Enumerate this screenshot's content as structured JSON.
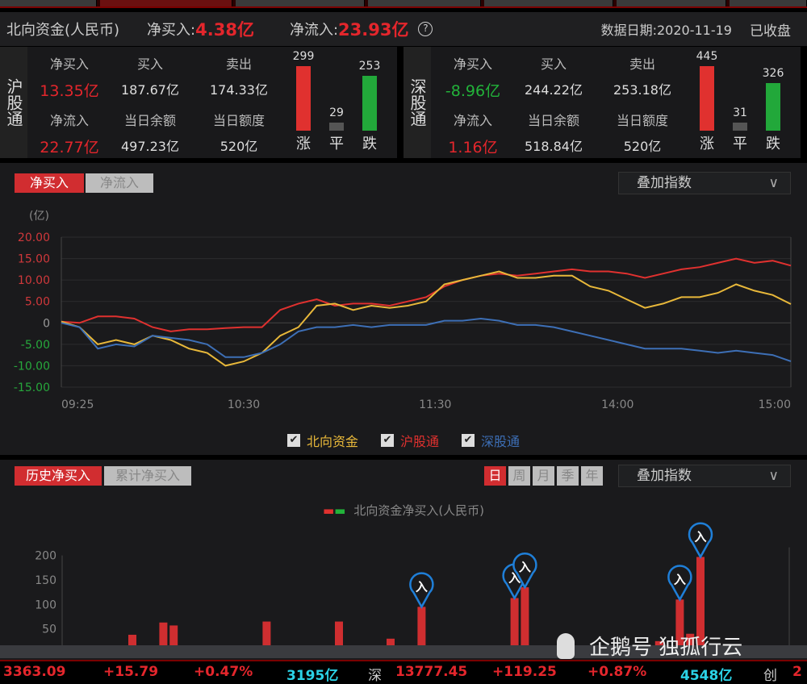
{
  "header": {
    "title": "北向资金(人民币)",
    "net_buy_label": "净买入:",
    "net_buy": "4.38亿",
    "net_flow_label": "净流入:",
    "net_flow": "23.93亿",
    "help_icon": "?",
    "date_label": "数据日期:2020-11-19",
    "status": "已收盘"
  },
  "sh": {
    "name": "沪股通",
    "net_buy_label": "净买入",
    "net_buy": "13.35亿",
    "buy_label": "买入",
    "buy": "187.67亿",
    "sell_label": "卖出",
    "sell": "174.33亿",
    "net_flow_label": "净流入",
    "net_flow": "22.77亿",
    "balance_label": "当日余额",
    "balance": "497.23亿",
    "quota_label": "当日额度",
    "quota": "520亿",
    "up": 299,
    "flat": 29,
    "down": 253,
    "up_label": "涨",
    "flat_label": "平",
    "down_label": "跌"
  },
  "sz": {
    "name": "深股通",
    "net_buy_label": "净买入",
    "net_buy": "-8.96亿",
    "buy_label": "买入",
    "buy": "244.22亿",
    "sell_label": "卖出",
    "sell": "253.18亿",
    "net_flow_label": "净流入",
    "net_flow": "1.16亿",
    "balance_label": "当日余额",
    "balance": "518.84亿",
    "quota_label": "当日额度",
    "quota": "520亿",
    "up": 445,
    "flat": 31,
    "down": 326,
    "up_label": "涨",
    "flat_label": "平",
    "down_label": "跌"
  },
  "intraday": {
    "tab_active": "净买入",
    "tab_inactive": "净流入",
    "overlay": "叠加指数",
    "chev": "∨",
    "unit": "(亿)",
    "legend": [
      {
        "name": "北向资金",
        "color": "#e8b83a"
      },
      {
        "name": "沪股通",
        "color": "#e0312f"
      },
      {
        "name": "深股通",
        "color": "#3d6fb6"
      }
    ],
    "check": "✔"
  },
  "chart_data": [
    {
      "type": "line",
      "ylabel": "(亿)",
      "ylim": [
        -15,
        20
      ],
      "yticks": [
        "20.00",
        "15.00",
        "10.00",
        "5.00",
        "0",
        "-5.00",
        "-10.00",
        "-15.00"
      ],
      "ytick_values": [
        20,
        15,
        10,
        5,
        0,
        -5,
        -10,
        -15
      ],
      "xticks": [
        "09:25",
        "10:30",
        "11:30",
        "14:00",
        "15:00"
      ],
      "xtick_index": [
        0,
        10,
        20.5,
        30.5,
        40
      ],
      "series": [
        {
          "name": "沪股通",
          "color": "#e0312f",
          "values": [
            0.3,
            0,
            1.5,
            1.5,
            1,
            -1,
            -2,
            -1.5,
            -1.5,
            -1.2,
            -1,
            -1,
            3,
            4.5,
            5.5,
            4,
            4.5,
            4.5,
            4,
            5,
            6,
            8.5,
            10,
            11,
            11.5,
            11,
            11.5,
            12,
            12.5,
            12,
            12,
            11.5,
            10.5,
            11.5,
            12.5,
            13,
            14,
            15,
            14,
            14.5,
            13.35
          ]
        },
        {
          "name": "北向资金",
          "color": "#e8b83a",
          "values": [
            0.3,
            -1,
            -5,
            -4,
            -5,
            -3,
            -4,
            -6,
            -7,
            -10,
            -9,
            -7,
            -3,
            -1,
            4,
            4.5,
            3,
            4,
            3.5,
            4,
            5,
            9,
            10,
            11,
            12,
            10.5,
            10.5,
            11,
            11,
            8.5,
            7.5,
            5.5,
            3.5,
            4.5,
            6,
            6,
            7,
            9,
            7.5,
            6.5,
            4.38
          ]
        },
        {
          "name": "深股通",
          "color": "#3d6fb6",
          "values": [
            0,
            -1,
            -6,
            -5,
            -5.5,
            -3,
            -3.5,
            -4,
            -5,
            -8,
            -8,
            -7,
            -5,
            -2,
            -1,
            -1,
            -0.5,
            -1,
            -0.5,
            -0.5,
            -0.5,
            0.5,
            0.5,
            1,
            0.5,
            -0.5,
            -0.5,
            -1,
            -2,
            -3,
            -4,
            -5,
            -6,
            -6,
            -6,
            -6.5,
            -7,
            -6.5,
            -7,
            -7.5,
            -8.96
          ]
        }
      ]
    },
    {
      "type": "bar",
      "title": "北向资金净买入(人民币)",
      "ylim": [
        0,
        200
      ],
      "yticks": [
        "200",
        "150",
        "100",
        "50"
      ],
      "ytick_values": [
        200,
        150,
        100,
        50
      ],
      "bar_index": [
        0,
        5,
        8,
        9,
        14,
        18,
        25,
        30,
        33,
        42,
        43,
        56,
        58,
        59,
        60
      ],
      "values": [
        5,
        38,
        63,
        57,
        3,
        65,
        65,
        30,
        95,
        113,
        135,
        25,
        110,
        40,
        197
      ],
      "marked_index": [
        8,
        9,
        10,
        12,
        14
      ],
      "marker_label": "入"
    }
  ],
  "history": {
    "tab_active": "历史净买入",
    "tab_inactive": "累计净买入",
    "periods": [
      "日",
      "周",
      "月",
      "季",
      "年"
    ],
    "overlay": "叠加指数",
    "chev": "∨",
    "legend_label": "北向资金净买入(人民币)"
  },
  "watermark": "企鹅号 独孤行云",
  "ticker": {
    "sh_index": "3363.09",
    "sh_change": "+15.79",
    "sh_pct": "+0.47%",
    "sh_amount": "3195亿",
    "sz_label": "深",
    "sz_index": "13777.45",
    "sz_change": "+119.25",
    "sz_pct": "+0.87%",
    "sz_amount": "4548亿",
    "cy_label": "创",
    "cy_cut": "2"
  }
}
